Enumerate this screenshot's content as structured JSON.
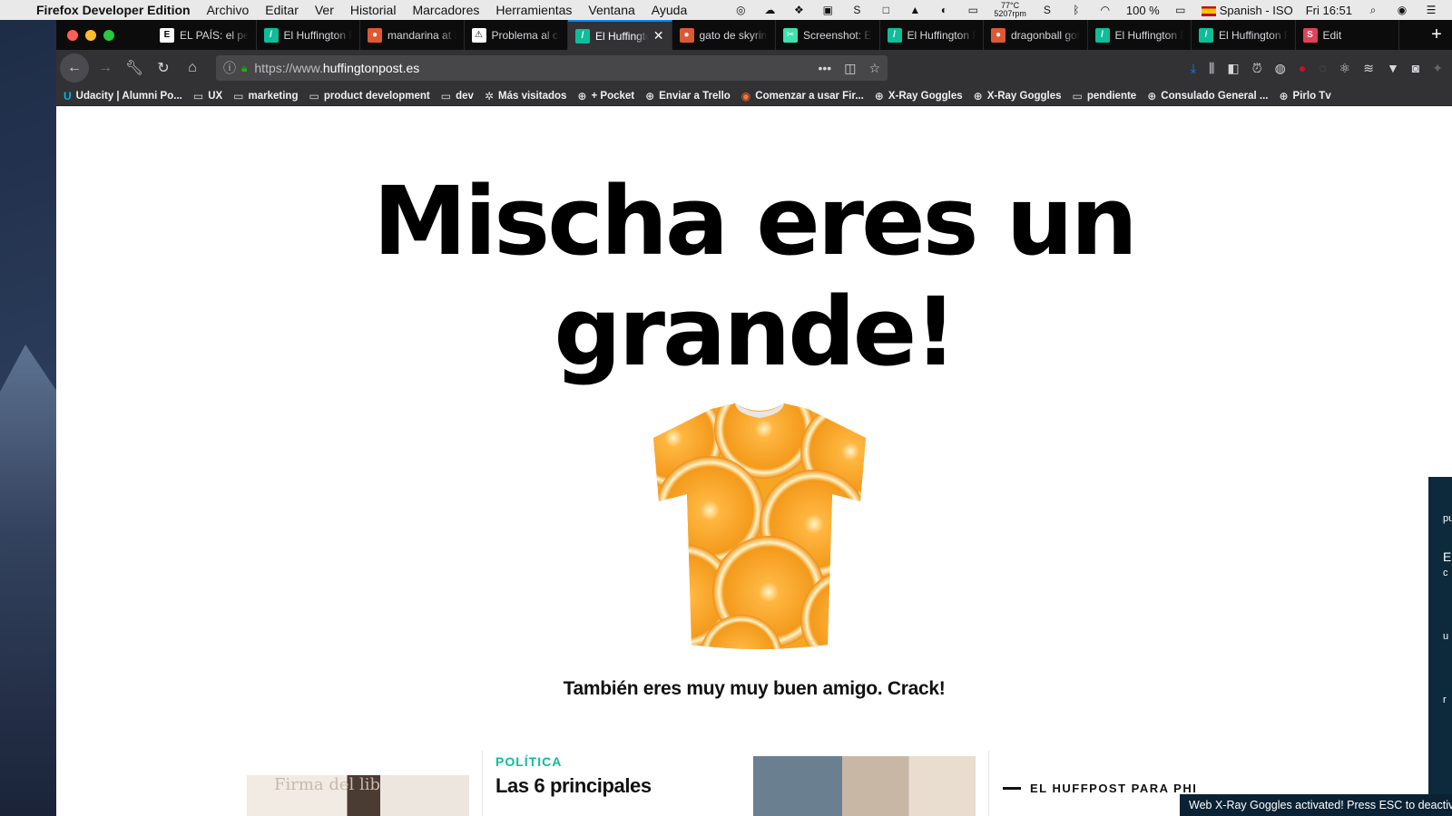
{
  "menubar": {
    "app_name": "Firefox Developer Edition",
    "menus": [
      "Archivo",
      "Editar",
      "Ver",
      "Historial",
      "Marcadores",
      "Herramientas",
      "Ventana",
      "Ayuda"
    ],
    "temperature": "77°C",
    "fan": "5207rpm",
    "battery": "100 %",
    "input_source": "Spanish - ISO",
    "clock": "Fri 16:51"
  },
  "tabs": [
    {
      "label": "EL PAÍS: el periódico",
      "favicon": "elpais-icon",
      "color": "#ffffff",
      "glyph": "E"
    },
    {
      "label": "El Huffington Post",
      "favicon": "huffpost-icon",
      "color": "#0dbe98",
      "glyph": "/"
    },
    {
      "label": "mandarina at DuckDuckGo",
      "favicon": "duckduckgo-icon",
      "color": "#de5833",
      "glyph": "●"
    },
    {
      "label": "Problema al cargar",
      "favicon": "warning-icon",
      "color": "#ffffff",
      "glyph": "⚠"
    },
    {
      "label": "El Huffington Post",
      "favicon": "huffpost-icon",
      "color": "#0dbe98",
      "glyph": "/",
      "active": true
    },
    {
      "label": "gato de skyrim",
      "favicon": "duckduckgo-icon",
      "color": "#de5833",
      "glyph": "●"
    },
    {
      "label": "Screenshot: Edit",
      "favicon": "screenshot-icon",
      "color": "#3fe1b0",
      "glyph": "✂"
    },
    {
      "label": "El Huffington Post",
      "favicon": "huffpost-icon",
      "color": "#0dbe98",
      "glyph": "/"
    },
    {
      "label": "dragonball gohan",
      "favicon": "duckduckgo-icon",
      "color": "#de5833",
      "glyph": "●"
    },
    {
      "label": "El Huffington Post",
      "favicon": "huffpost-icon",
      "color": "#0dbe98",
      "glyph": "/"
    },
    {
      "label": "El Huffington Post",
      "favicon": "huffpost-icon",
      "color": "#0dbe98",
      "glyph": "/"
    },
    {
      "label": "Edit",
      "favicon": "edit-s-icon",
      "color": "#e0415a",
      "glyph": "S"
    }
  ],
  "url": {
    "prefix": "https://www.",
    "domain": "huffingtonpost.es"
  },
  "bookmarks": [
    {
      "label": "Udacity | Alumni Po...",
      "icon": "udacity-icon",
      "glyph": "U"
    },
    {
      "label": "UX",
      "icon": "folder-icon",
      "glyph": "▭"
    },
    {
      "label": "marketing",
      "icon": "folder-icon",
      "glyph": "▭"
    },
    {
      "label": "product development",
      "icon": "folder-icon",
      "glyph": "▭"
    },
    {
      "label": "dev",
      "icon": "folder-icon",
      "glyph": "▭"
    },
    {
      "label": "Más visitados",
      "icon": "gear-icon",
      "glyph": "✲"
    },
    {
      "label": "+ Pocket",
      "icon": "globe-icon",
      "glyph": "⊕"
    },
    {
      "label": "Enviar a Trello",
      "icon": "globe-icon",
      "glyph": "⊕"
    },
    {
      "label": "Comenzar a usar Fir...",
      "icon": "firefox-icon",
      "glyph": "◉"
    },
    {
      "label": "X-Ray Goggles",
      "icon": "globe-icon",
      "glyph": "⊕"
    },
    {
      "label": "X-Ray Goggles",
      "icon": "globe-icon",
      "glyph": "⊕"
    },
    {
      "label": "pendiente",
      "icon": "folder-icon",
      "glyph": "▭"
    },
    {
      "label": "Consulado General ...",
      "icon": "globe-icon",
      "glyph": "⊕"
    },
    {
      "label": "Pirlo Tv",
      "icon": "globe-icon",
      "glyph": "⊕"
    }
  ],
  "page": {
    "headline_line1": "Mischa eres un",
    "headline_line2": "grande!",
    "subhead": "También eres muy muy buen amigo. Crack!",
    "card_image_text": "Firma\ndel lib",
    "category": "POLÍTICA",
    "card_title": "Las 6 principales",
    "section_label": "EL HUFFPOST PARA PHI",
    "side_panel_letters": [
      "pu",
      "E",
      "c",
      "u",
      "r"
    ],
    "xray_notice": "Web X-Ray Goggles activated! Press ESC to deactivate."
  }
}
